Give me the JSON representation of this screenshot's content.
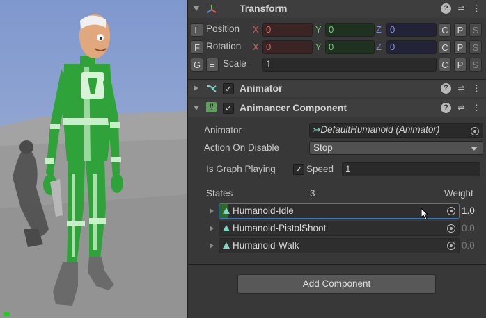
{
  "scene": {
    "sky_color": "#8ea3d1",
    "ground_color": "#a0a0a0",
    "character_color": "#2fa33a"
  },
  "transform": {
    "title": "Transform",
    "icons": [
      "help-icon",
      "presets-icon",
      "context-menu-icon"
    ],
    "rows": [
      {
        "key": "L",
        "label": "Position",
        "x_axis": "X",
        "x": "0",
        "y_axis": "Y",
        "y": "0",
        "z_axis": "Z",
        "z": "0",
        "buttons": [
          "C",
          "P",
          "S"
        ]
      },
      {
        "key": "F",
        "label": "Rotation",
        "x_axis": "X",
        "x": "0",
        "y_axis": "Y",
        "y": "0",
        "z_axis": "Z",
        "z": "0",
        "buttons": [
          "C",
          "P",
          "S"
        ]
      },
      {
        "key": "G",
        "key2": "=",
        "label": "Scale",
        "value": "1",
        "buttons": [
          "C",
          "P",
          "S"
        ]
      }
    ]
  },
  "animator": {
    "title": "Animator",
    "enabled": true
  },
  "animancer": {
    "title": "Animancer Component",
    "enabled": true,
    "animator_label": "Animator",
    "animator_value": "DefaultHumanoid (Animator)",
    "action_label": "Action On Disable",
    "action_value": "Stop",
    "graph_playing_label": "Is Graph Playing",
    "graph_playing": true,
    "speed_label": "Speed",
    "speed_value": "1",
    "states_label": "States",
    "states_count": "3",
    "weight_label": "Weight",
    "states": [
      {
        "name": "Humanoid-Idle",
        "weight": "1.0",
        "selected": true
      },
      {
        "name": "Humanoid-PistolShoot",
        "weight": "0.0",
        "selected": false
      },
      {
        "name": "Humanoid-Walk",
        "weight": "0.0",
        "selected": false
      }
    ]
  },
  "footer": {
    "add_component": "Add Component"
  }
}
